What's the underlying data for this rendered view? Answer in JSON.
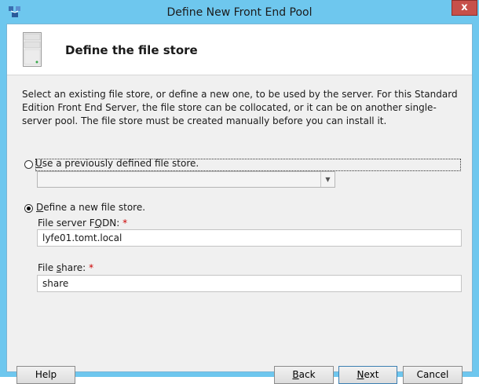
{
  "window": {
    "title": "Define New Front End Pool",
    "close_glyph": "x"
  },
  "header": {
    "title": "Define the file store",
    "icon": "server-icon"
  },
  "description": "Select an existing file store, or define a new one, to be used by the server. For this Standard Edition Front End Server, the file store can be collocated, or it can be on another single-server pool. The file store must be created manually before you can install it.",
  "options": {
    "existing": {
      "label_pre": "",
      "label_accel": "U",
      "label_post": "se a previously defined file store.",
      "selected": false,
      "combo_value": ""
    },
    "new": {
      "label_pre": "",
      "label_accel": "D",
      "label_post": "efine a new file store.",
      "selected": true
    }
  },
  "fields": {
    "fqdn": {
      "label_pre": "File server F",
      "label_accel": "Q",
      "label_post": "DN:",
      "required_mark": "*",
      "value": "lyfe01.tomt.local"
    },
    "share": {
      "label_pre": "File ",
      "label_accel": "s",
      "label_post": "hare:",
      "required_mark": "*",
      "value": "share"
    }
  },
  "buttons": {
    "help": "Help",
    "back_accel": "B",
    "back_rest": "ack",
    "next_accel": "N",
    "next_rest": "ext",
    "cancel": "Cancel"
  },
  "colors": {
    "titlebar": "#6ec7ee",
    "close": "#c7504a",
    "required": "#cc0000"
  }
}
